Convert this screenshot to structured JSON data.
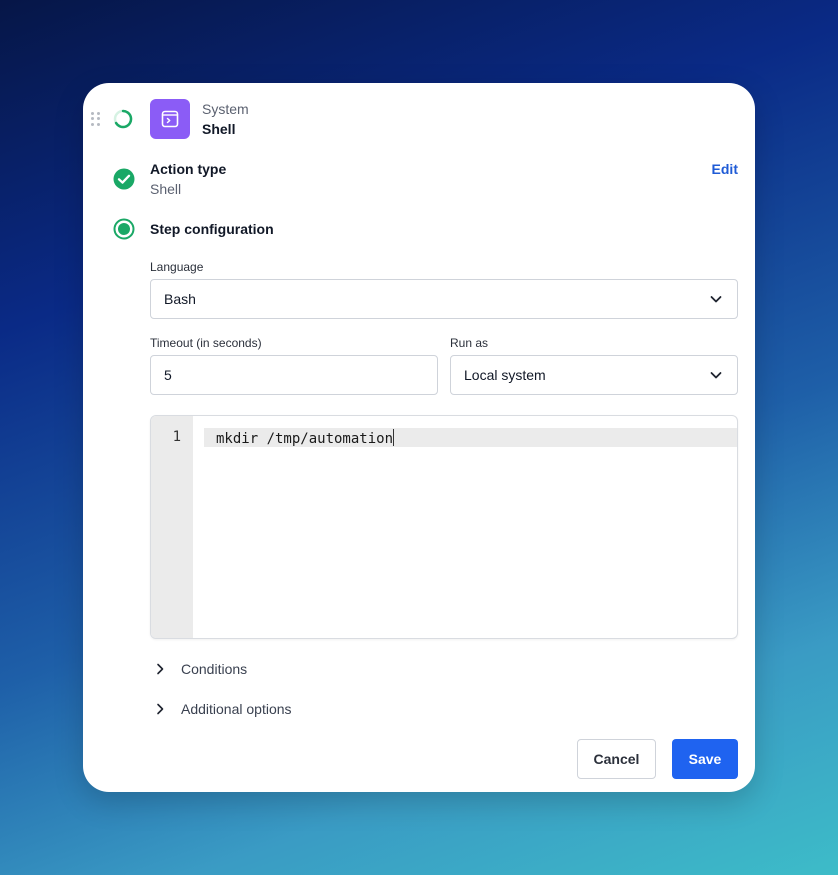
{
  "header": {
    "category": "System",
    "app_name": "Shell",
    "app_icon": "terminal-icon",
    "status_icon": "spinner-icon",
    "accent_color": "#8b5cf6"
  },
  "action_type": {
    "title": "Action type",
    "value": "Shell",
    "edit_label": "Edit",
    "status_icon": "check-circle-icon",
    "status_color": "#1aa866"
  },
  "step_configuration": {
    "title": "Step configuration",
    "status_icon": "radio-active-icon",
    "language": {
      "label": "Language",
      "selected": "Bash"
    },
    "timeout": {
      "label": "Timeout (in seconds)",
      "value": "5"
    },
    "run_as": {
      "label": "Run as",
      "selected": "Local system"
    },
    "code_editor": {
      "lines": [
        {
          "number": "1",
          "text": "mkdir /tmp/automation"
        }
      ]
    }
  },
  "sections": {
    "conditions_label": "Conditions",
    "additional_options_label": "Additional options"
  },
  "footer": {
    "cancel_label": "Cancel",
    "save_label": "Save",
    "save_color": "#1f63f0"
  }
}
